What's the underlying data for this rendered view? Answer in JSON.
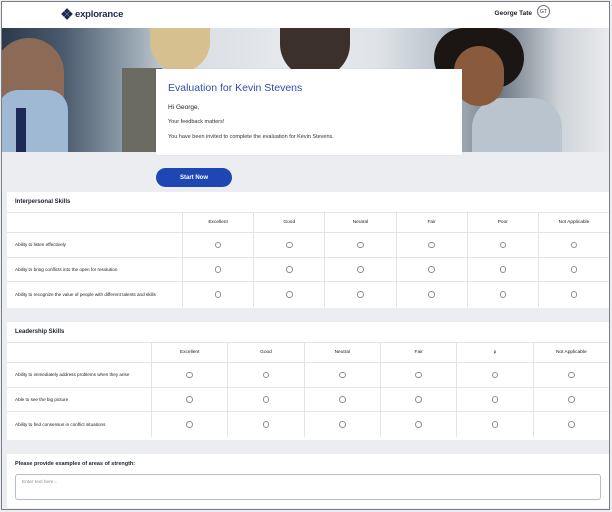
{
  "header": {
    "logo_text": "explorance",
    "user_name": "George Tate",
    "user_initials": "GT"
  },
  "intro": {
    "title": "Evaluation for Kevin Stevens",
    "greeting": "Hi George,",
    "line1": "Your feedback matters!",
    "line2": "You have been invited to complete the evaluation for Kevin Stevens."
  },
  "start_button": "Start Now",
  "sections": [
    {
      "title": "Interpersonal Skills",
      "columns": [
        "Excellent",
        "Good",
        "Neutral",
        "Fair",
        "Poor",
        "Not Applicable"
      ],
      "rows": [
        "Ability to listen effectively",
        "Ability to bring conflicts into the open for resolution",
        "Ability to recognize the value of people with different talents and skills"
      ]
    },
    {
      "title": "Leadership Skills",
      "columns": [
        "Excellent",
        "Good",
        "Neutral",
        "Fair",
        "p",
        "Not Applicable"
      ],
      "rows": [
        "Ability to immediately address problems when they arise",
        "Able to see the big picture",
        "Ability to find consensus in conflict situations"
      ]
    }
  ],
  "strengths": {
    "question": "Please provide examples of areas of strength:",
    "placeholder": "Enter text here..."
  }
}
